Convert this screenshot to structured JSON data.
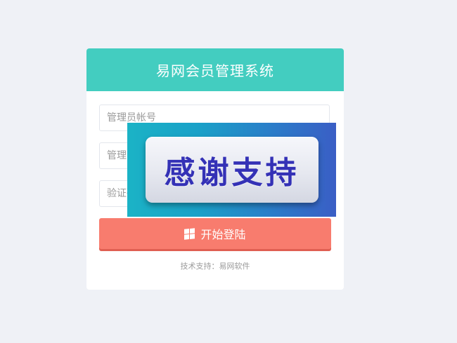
{
  "header": {
    "title": "易网会员管理系统"
  },
  "form": {
    "username_placeholder": "管理员帐号",
    "password_placeholder": "管理员密码",
    "captcha_placeholder": "验证码",
    "login_label": "开始登陆"
  },
  "footer": {
    "text": "技术支持：易网软件"
  },
  "overlay": {
    "text": "感谢支持"
  },
  "colors": {
    "header": "#43cdc0",
    "login_button": "#f87c6e",
    "background": "#eff1f6",
    "overlay_text": "#3431b6"
  },
  "icons": {
    "login": "windows-icon"
  }
}
